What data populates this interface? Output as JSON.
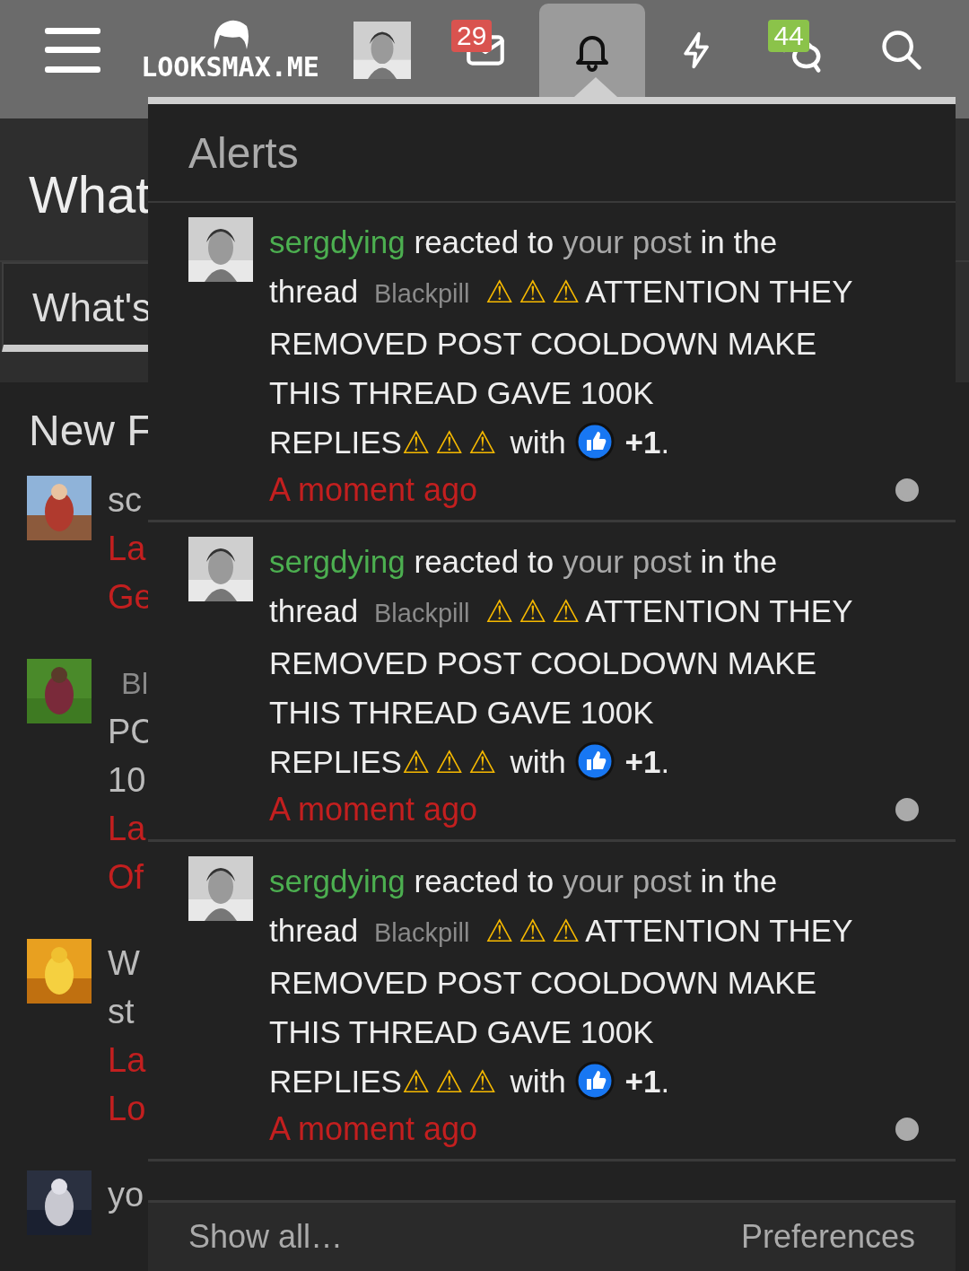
{
  "header": {
    "logo": "LOOKSMAX.ME",
    "nav": [
      {
        "kind": "menu",
        "selected": false
      },
      {
        "kind": "avatar",
        "selected": false
      },
      {
        "kind": "inbox",
        "badge": "29",
        "selected": false
      },
      {
        "kind": "alerts",
        "selected": true
      },
      {
        "kind": "whats-new",
        "selected": false
      },
      {
        "kind": "conversations",
        "badge": "44",
        "selected": false
      },
      {
        "kind": "search",
        "selected": false
      }
    ]
  },
  "background": {
    "title": "What",
    "tab": "What's",
    "section": "New F",
    "threads": [
      {
        "lines": [
          {
            "kind": "title",
            "text": "sc"
          },
          {
            "kind": "meta",
            "text": "La"
          },
          {
            "kind": "meta",
            "text": "Ge"
          }
        ]
      },
      {
        "lines": [
          {
            "kind": "prefix",
            "text": "Bl"
          },
          {
            "kind": "title",
            "text": "PC"
          },
          {
            "kind": "title",
            "text": "10"
          },
          {
            "kind": "meta",
            "text": "La"
          },
          {
            "kind": "meta",
            "text": "Of"
          }
        ]
      },
      {
        "lines": [
          {
            "kind": "title",
            "text": "W"
          },
          {
            "kind": "title",
            "text": "st"
          },
          {
            "kind": "meta",
            "text": "La"
          },
          {
            "kind": "meta",
            "text": "Lo"
          }
        ]
      },
      {
        "lines": [
          {
            "kind": "title",
            "text": "yo"
          }
        ]
      }
    ]
  },
  "alerts": {
    "title": "Alerts",
    "items": [
      {
        "unread": true,
        "time": "A moment ago",
        "segments": [
          {
            "kind": "user",
            "text": "sergdying"
          },
          {
            "kind": "text",
            "text": " reacted to "
          },
          {
            "kind": "link",
            "text": "your post"
          },
          {
            "kind": "text",
            "text": " in the thread "
          },
          {
            "kind": "prefix",
            "text": "Blackpill"
          },
          {
            "kind": "warning",
            "text": "⚠⚠⚠"
          },
          {
            "kind": "text",
            "text": "ATTENTION THEY REMOVED POST COOLDOWN MAKE THIS THREAD GAVE 100K REPLIES"
          },
          {
            "kind": "warning",
            "text": "⚠⚠⚠"
          },
          {
            "kind": "text",
            "text": " with "
          },
          {
            "kind": "reaction"
          },
          {
            "kind": "text",
            "text": "**+1**."
          }
        ]
      },
      {
        "unread": true,
        "time": "A moment ago",
        "segments": [
          {
            "kind": "user",
            "text": "sergdying"
          },
          {
            "kind": "text",
            "text": " reacted to "
          },
          {
            "kind": "link",
            "text": "your post"
          },
          {
            "kind": "text",
            "text": " in the thread "
          },
          {
            "kind": "prefix",
            "text": "Blackpill"
          },
          {
            "kind": "warning",
            "text": "⚠⚠⚠"
          },
          {
            "kind": "text",
            "text": "ATTENTION THEY REMOVED POST COOLDOWN MAKE THIS THREAD GAVE 100K REPLIES"
          },
          {
            "kind": "warning",
            "text": "⚠⚠⚠"
          },
          {
            "kind": "text",
            "text": " with "
          },
          {
            "kind": "reaction"
          },
          {
            "kind": "text",
            "text": "**+1**."
          }
        ]
      },
      {
        "unread": true,
        "time": "A moment ago",
        "segments": [
          {
            "kind": "user",
            "text": "sergdying"
          },
          {
            "kind": "text",
            "text": " reacted to "
          },
          {
            "kind": "link",
            "text": "your post"
          },
          {
            "kind": "text",
            "text": " in the thread "
          },
          {
            "kind": "prefix",
            "text": "Blackpill"
          },
          {
            "kind": "warning",
            "text": "⚠⚠⚠"
          },
          {
            "kind": "text",
            "text": "ATTENTION THEY REMOVED POST COOLDOWN MAKE THIS THREAD GAVE 100K REPLIES"
          },
          {
            "kind": "warning",
            "text": "⚠⚠⚠"
          },
          {
            "kind": "text",
            "text": " with "
          },
          {
            "kind": "reaction"
          },
          {
            "kind": "text",
            "text": "**+1**."
          }
        ]
      }
    ],
    "footer": {
      "show_all": "Show all…",
      "preferences": "Preferences"
    }
  }
}
